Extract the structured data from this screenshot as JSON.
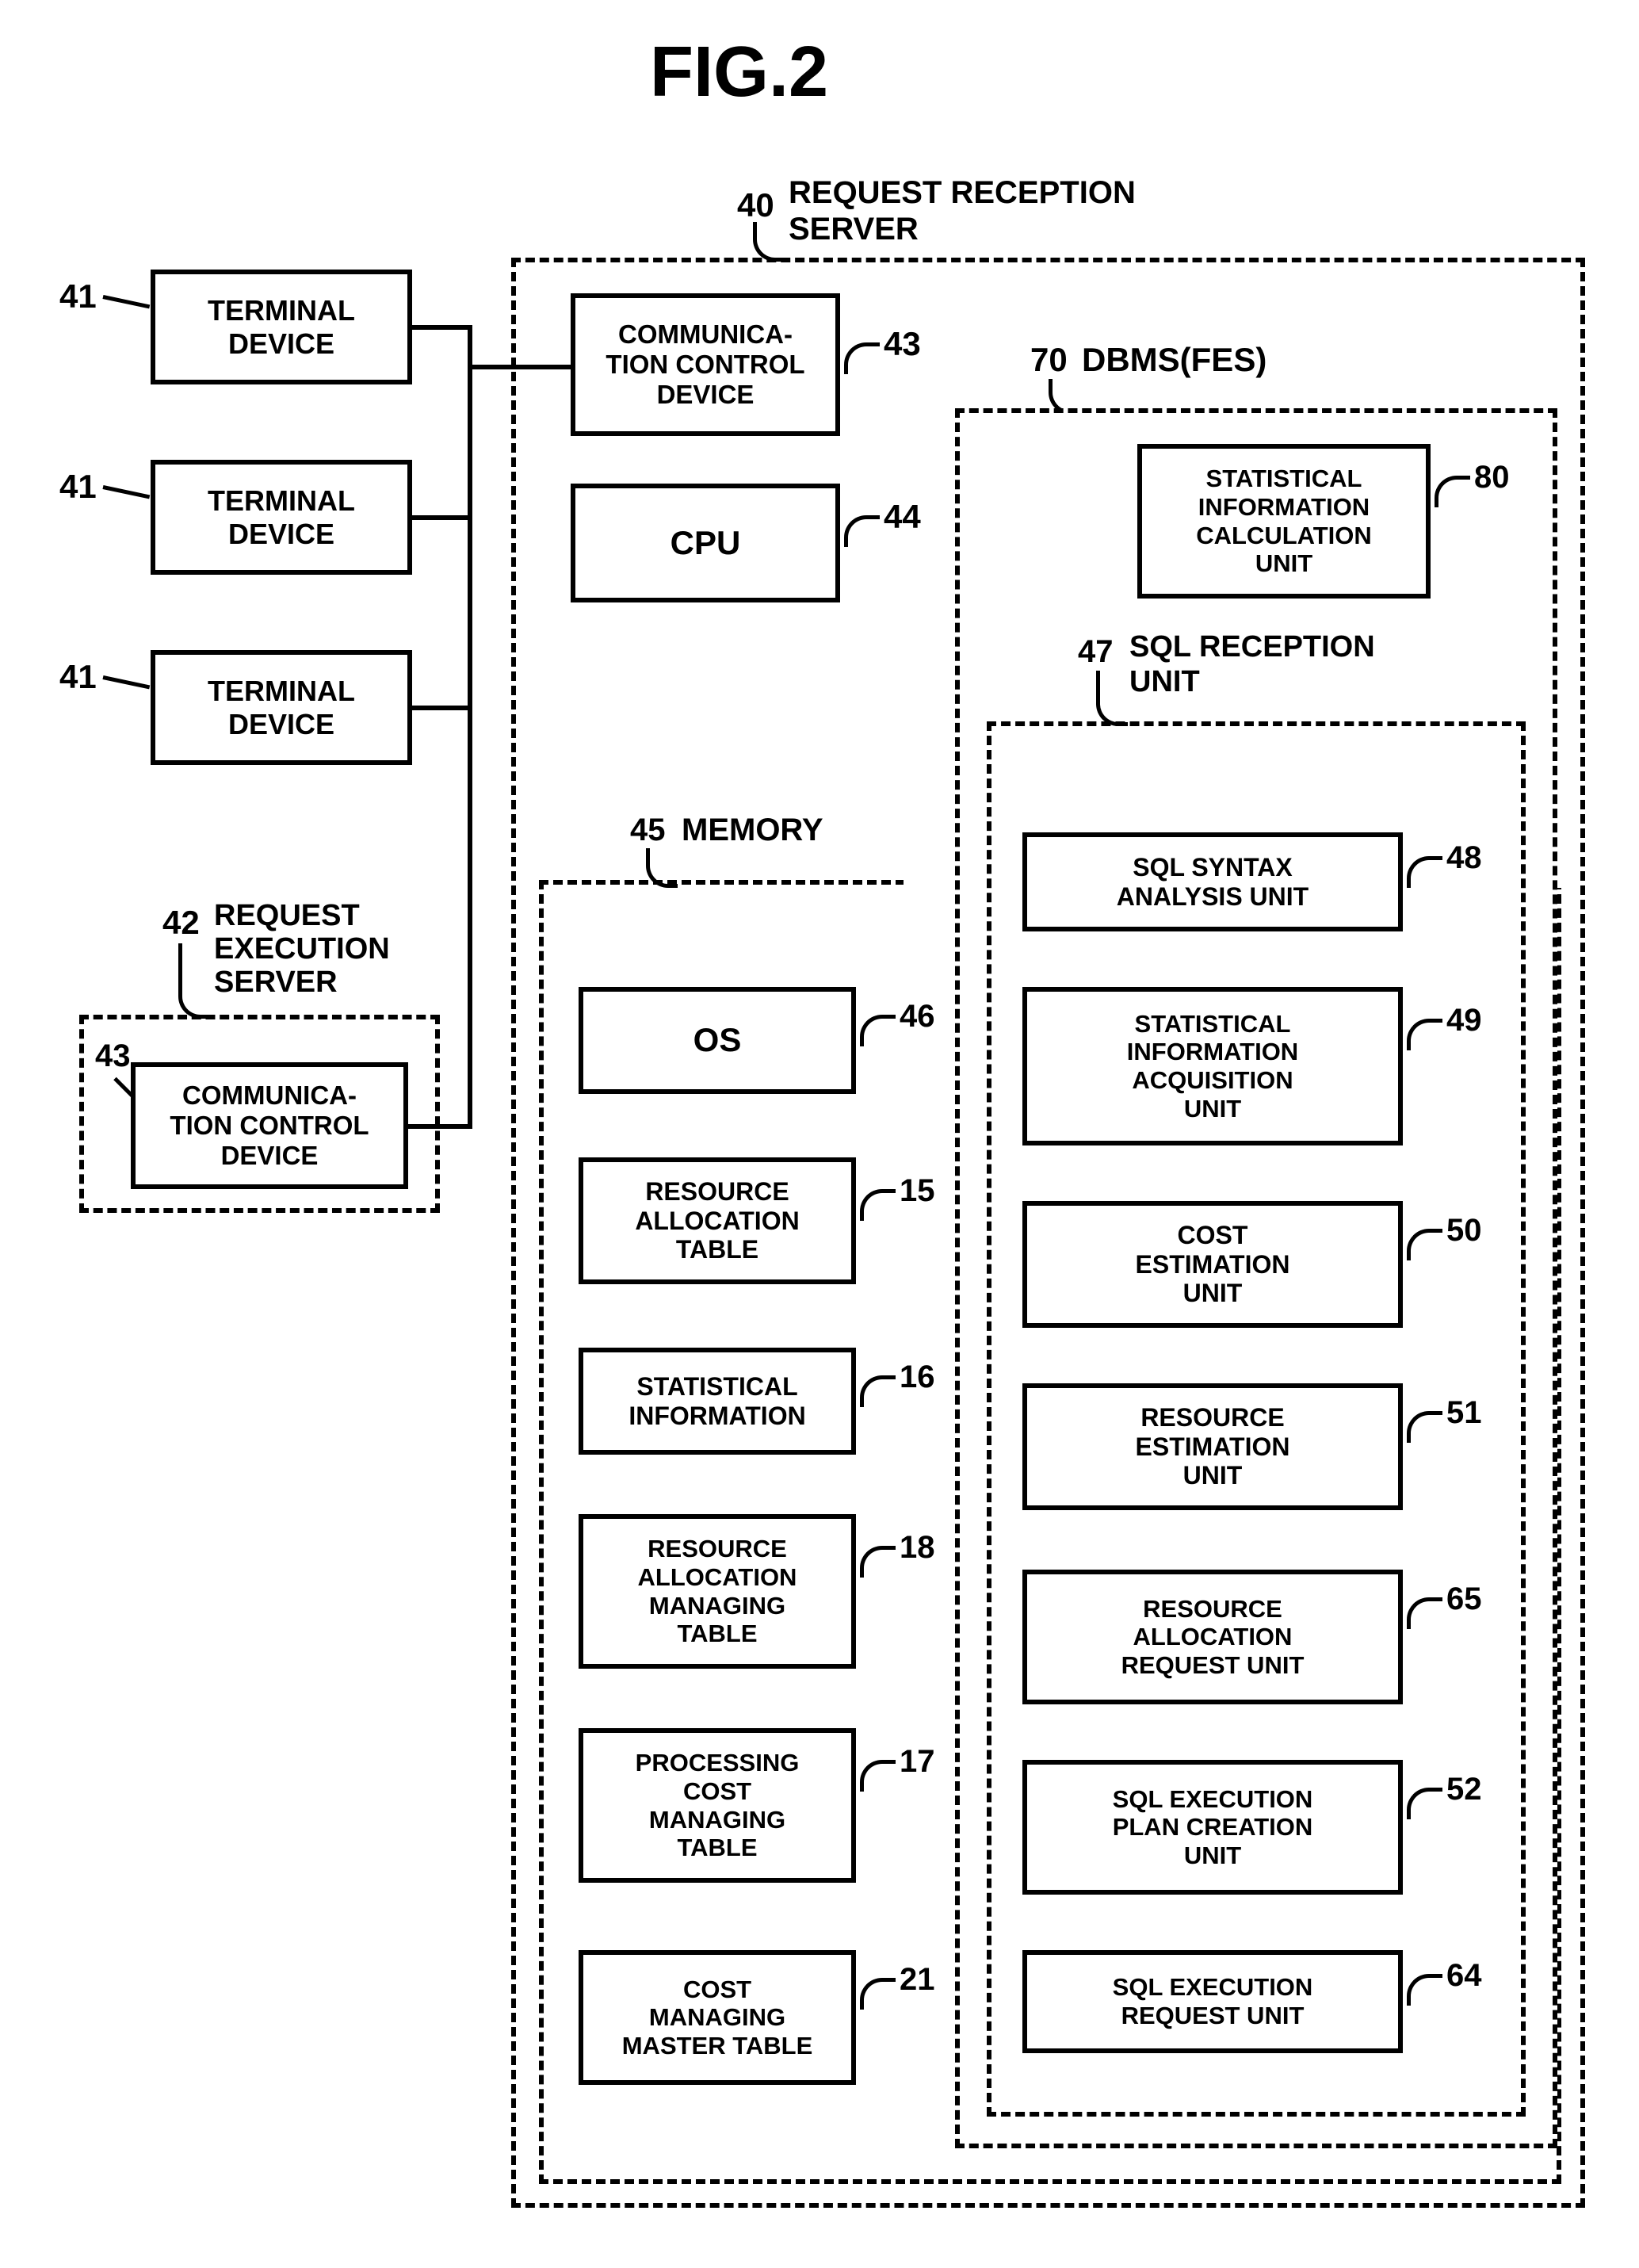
{
  "figure_title": "FIG.2",
  "terminals": {
    "t1": {
      "ref": "41",
      "label": "TERMINAL\nDEVICE"
    },
    "t2": {
      "ref": "41",
      "label": "TERMINAL\nDEVICE"
    },
    "t3": {
      "ref": "41",
      "label": "TERMINAL\nDEVICE"
    }
  },
  "request_execution_server": {
    "ref": "42",
    "label": "REQUEST\nEXECUTION\nSERVER",
    "comm_control": {
      "ref": "43",
      "label": "COMMUNICA-\nTION CONTROL\nDEVICE"
    }
  },
  "request_reception_server": {
    "ref": "40",
    "label": "REQUEST RECEPTION\nSERVER",
    "comm_control": {
      "ref": "43",
      "label": "COMMUNICA-\nTION CONTROL\nDEVICE"
    },
    "cpu": {
      "ref": "44",
      "label": "CPU"
    }
  },
  "memory": {
    "ref": "45",
    "label": "MEMORY",
    "os": {
      "ref": "46",
      "label": "OS"
    },
    "resource_allocation_table": {
      "ref": "15",
      "label": "RESOURCE\nALLOCATION\nTABLE"
    },
    "statistical_information": {
      "ref": "16",
      "label": "STATISTICAL\nINFORMATION"
    },
    "resource_allocation_managing_table": {
      "ref": "18",
      "label": "RESOURCE\nALLOCATION\nMANAGING\nTABLE"
    },
    "processing_cost_managing_table": {
      "ref": "17",
      "label": "PROCESSING\nCOST\nMANAGING\nTABLE"
    },
    "cost_managing_master_table": {
      "ref": "21",
      "label": "COST\nMANAGING\nMASTER TABLE"
    }
  },
  "dbms": {
    "ref": "70",
    "label": "DBMS(FES)",
    "statistical_info_calc_unit": {
      "ref": "80",
      "label": "STATISTICAL\nINFORMATION\nCALCULATION\nUNIT"
    }
  },
  "sql_reception_unit": {
    "ref": "47",
    "label": "SQL RECEPTION\nUNIT",
    "sql_syntax_analysis_unit": {
      "ref": "48",
      "label": "SQL SYNTAX\nANALYSIS UNIT"
    },
    "statistical_info_acquisition_unit": {
      "ref": "49",
      "label": "STATISTICAL\nINFORMATION\nACQUISITION\nUNIT"
    },
    "cost_estimation_unit": {
      "ref": "50",
      "label": "COST\nESTIMATION\nUNIT"
    },
    "resource_estimation_unit": {
      "ref": "51",
      "label": "RESOURCE\nESTIMATION\nUNIT"
    },
    "resource_allocation_request_unit": {
      "ref": "65",
      "label": "RESOURCE\nALLOCATION\nREQUEST UNIT"
    },
    "sql_execution_plan_creation_unit": {
      "ref": "52",
      "label": "SQL EXECUTION\nPLAN CREATION\nUNIT"
    },
    "sql_execution_request_unit": {
      "ref": "64",
      "label": "SQL EXECUTION\nREQUEST UNIT"
    }
  },
  "chart_data": {
    "type": "diagram",
    "title": "FIG.2",
    "description": "Block diagram of a request reception server (40) containing a communication control device (43), CPU (44), memory (45) with OS and tables, and DBMS(FES) (70) containing statistical information calculation unit (80) and SQL reception unit (47). Terminal devices (41) and a request execution server (42) connect to the request reception server.",
    "blocks": [
      {
        "id": 41,
        "name": "TERMINAL DEVICE",
        "count": 3
      },
      {
        "id": 42,
        "name": "REQUEST EXECUTION SERVER"
      },
      {
        "id": 43,
        "name": "COMMUNICATION CONTROL DEVICE",
        "in": [
          42,
          40
        ]
      },
      {
        "id": 40,
        "name": "REQUEST RECEPTION SERVER"
      },
      {
        "id": 44,
        "name": "CPU",
        "in": 40
      },
      {
        "id": 45,
        "name": "MEMORY",
        "in": 40
      },
      {
        "id": 46,
        "name": "OS",
        "in": 45
      },
      {
        "id": 15,
        "name": "RESOURCE ALLOCATION TABLE",
        "in": 45
      },
      {
        "id": 16,
        "name": "STATISTICAL INFORMATION",
        "in": 45
      },
      {
        "id": 18,
        "name": "RESOURCE ALLOCATION MANAGING TABLE",
        "in": 45
      },
      {
        "id": 17,
        "name": "PROCESSING COST MANAGING TABLE",
        "in": 45
      },
      {
        "id": 21,
        "name": "COST MANAGING MASTER TABLE",
        "in": 45
      },
      {
        "id": 70,
        "name": "DBMS(FES)",
        "in": 40
      },
      {
        "id": 80,
        "name": "STATISTICAL INFORMATION CALCULATION UNIT",
        "in": 70
      },
      {
        "id": 47,
        "name": "SQL RECEPTION UNIT",
        "in": 70
      },
      {
        "id": 48,
        "name": "SQL SYNTAX ANALYSIS UNIT",
        "in": 47
      },
      {
        "id": 49,
        "name": "STATISTICAL INFORMATION ACQUISITION UNIT",
        "in": 47
      },
      {
        "id": 50,
        "name": "COST ESTIMATION UNIT",
        "in": 47
      },
      {
        "id": 51,
        "name": "RESOURCE ESTIMATION UNIT",
        "in": 47
      },
      {
        "id": 65,
        "name": "RESOURCE ALLOCATION REQUEST UNIT",
        "in": 47
      },
      {
        "id": 52,
        "name": "SQL EXECUTION PLAN CREATION UNIT",
        "in": 47
      },
      {
        "id": 64,
        "name": "SQL EXECUTION REQUEST UNIT",
        "in": 47
      }
    ],
    "connections": [
      {
        "from": 41,
        "to": 43
      },
      {
        "from": 42,
        "to": 43
      }
    ]
  }
}
